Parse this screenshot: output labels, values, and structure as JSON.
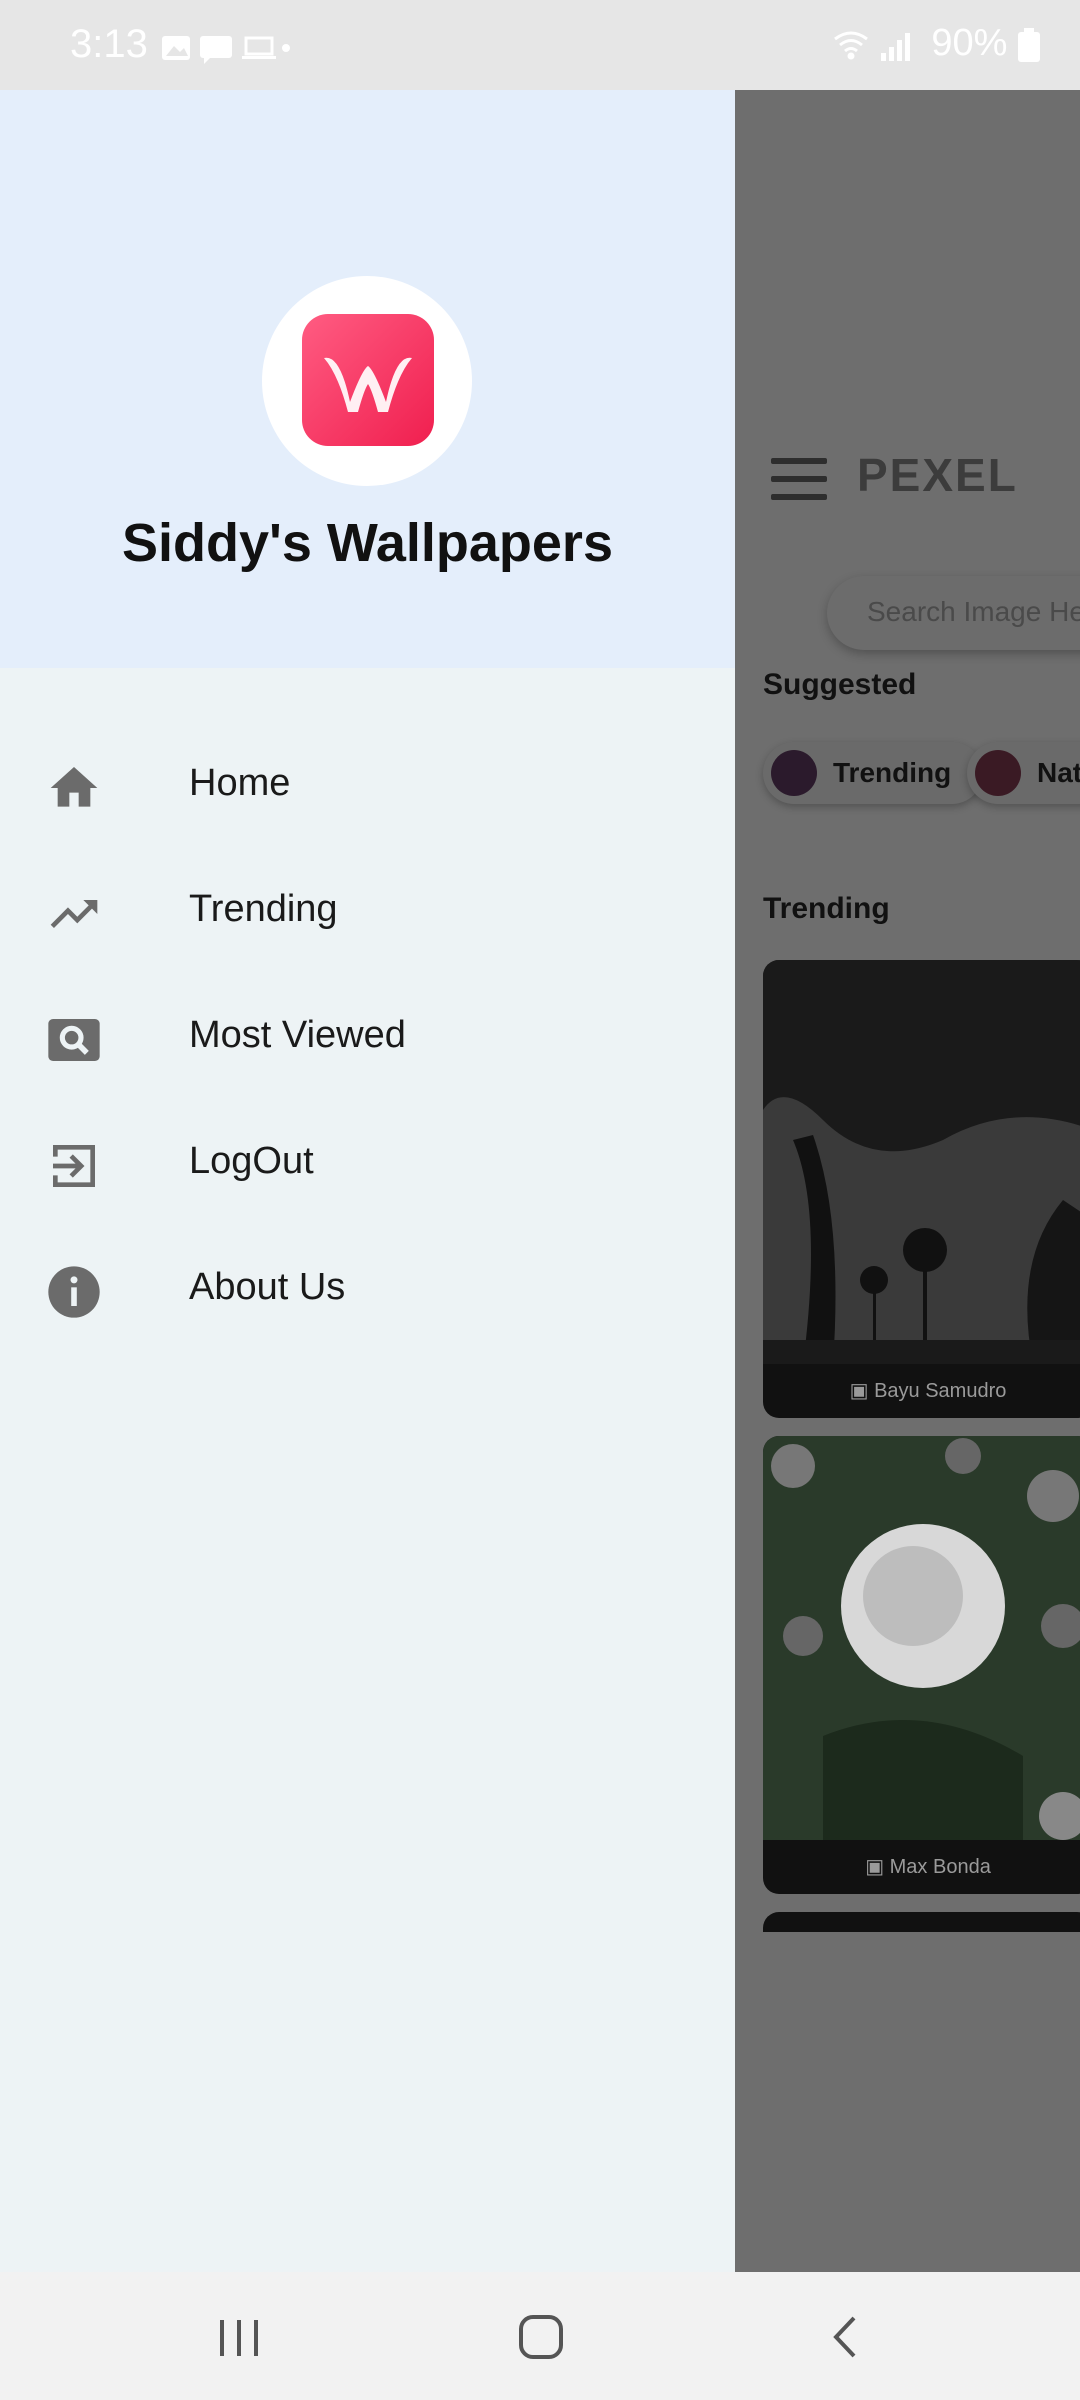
{
  "status_bar": {
    "time": "3:13",
    "battery": "90%",
    "icons_left": [
      "image-icon",
      "message-icon",
      "laptop-icon",
      "dot-icon"
    ],
    "icons_right": [
      "wifi-icon",
      "signal-icon",
      "battery-icon"
    ]
  },
  "drawer": {
    "app_name": "Siddy's Wallpapers",
    "items": [
      {
        "label": "Home",
        "icon": "home-icon"
      },
      {
        "label": "Trending",
        "icon": "trending-icon"
      },
      {
        "label": "Most Viewed",
        "icon": "image-search-icon"
      },
      {
        "label": "LogOut",
        "icon": "logout-icon"
      },
      {
        "label": "About Us",
        "icon": "info-icon"
      }
    ]
  },
  "app": {
    "title": "PEXEL",
    "search_placeholder": "Search Image Here",
    "suggested_title": "Suggested",
    "chips": [
      {
        "label": "Trending"
      },
      {
        "label": "Nat"
      }
    ],
    "trending_title": "Trending",
    "cards": [
      {
        "caption": "Bayu Samudro"
      },
      {
        "caption": "Max Bonda"
      }
    ]
  },
  "colors": {
    "drawer_bg": "#edf3f5",
    "header_bg": "#e4eefb",
    "logo_gradient_start": "#ff5c82",
    "logo_gradient_end": "#f01f4f",
    "scrim": "#6e6e6e"
  }
}
